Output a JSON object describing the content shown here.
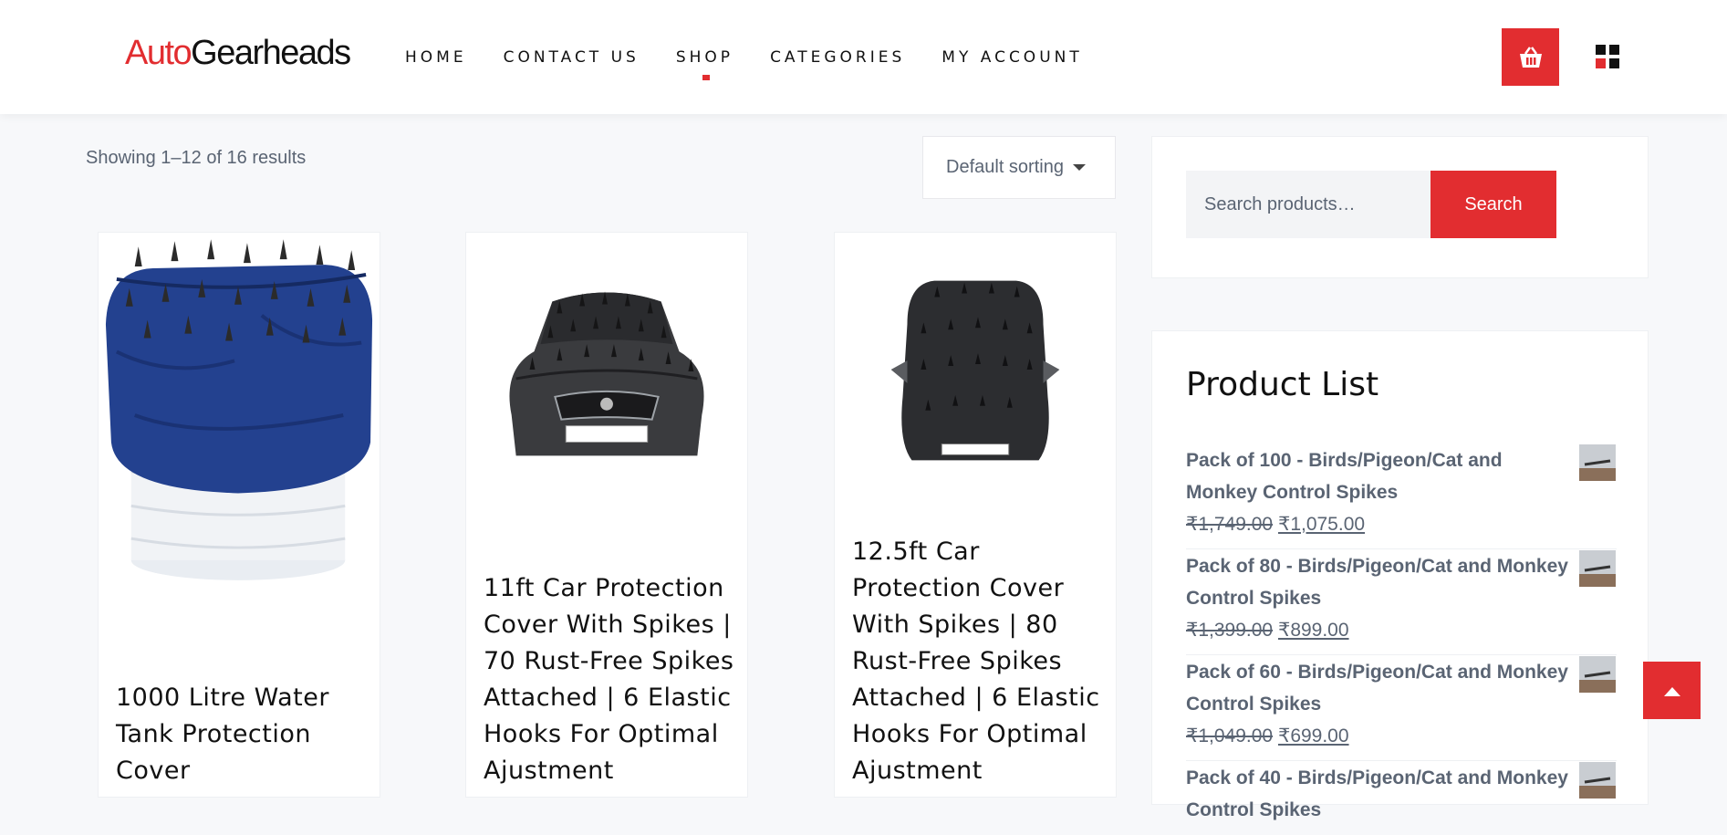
{
  "header": {
    "logo_part1": "Auto",
    "logo_part2": "Gearheads",
    "nav": [
      "HOME",
      "CONTACT US",
      "SHOP",
      "CATEGORIES",
      "MY ACCOUNT"
    ],
    "active_nav": "SHOP"
  },
  "shop": {
    "result_count": "Showing 1–12 of 16 results",
    "sorting": "Default sorting",
    "products": [
      {
        "title": "1000 Litre Water Tank Protection Cover"
      },
      {
        "title": "11ft Car Protection Cover With Spikes | 70 Rust-Free Spikes Attached | 6 Elastic Hooks For Optimal Ajustment"
      },
      {
        "title": "12.5ft Car Protection Cover With Spikes | 80 Rust-Free Spikes Attached | 6 Elastic Hooks For Optimal Ajustment"
      }
    ]
  },
  "sidebar": {
    "search_placeholder": "Search products…",
    "search_button": "Search",
    "product_list_title": "Product List",
    "product_list": [
      {
        "name": "Pack of 100 - Birds/Pigeon/Cat and Monkey Control Spikes",
        "old_price": "₹1,749.00",
        "price": "₹1,075.00"
      },
      {
        "name": "Pack of 80 - Birds/Pigeon/Cat and Monkey Control Spikes",
        "old_price": "₹1,399.00",
        "price": "₹899.00"
      },
      {
        "name": "Pack of 60 - Birds/Pigeon/Cat and Monkey Control Spikes",
        "old_price": "₹1,049.00",
        "price": "₹699.00"
      },
      {
        "name": "Pack of 40 - Birds/Pigeon/Cat and Monkey Control Spikes"
      }
    ]
  },
  "colors": {
    "accent": "#e22d30",
    "text": "#111111",
    "muted": "#5a6473"
  }
}
